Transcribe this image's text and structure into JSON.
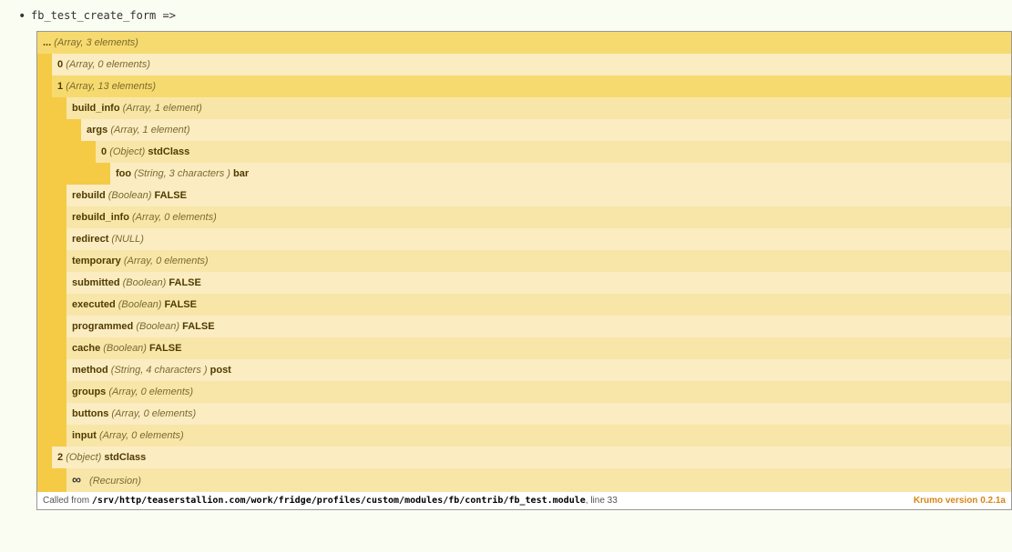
{
  "header": {
    "label": "fb_test_create_form =>"
  },
  "root": {
    "key": "...",
    "type": "(Array, 3 elements)"
  },
  "items": {
    "i0": {
      "key": "0",
      "type": "(Array, 0 elements)"
    },
    "i1": {
      "key": "1",
      "type": "(Array, 13 elements)"
    },
    "i1c": {
      "build_info": {
        "key": "build_info",
        "type": "(Array, 1 element)"
      },
      "args": {
        "key": "args",
        "type": "(Array, 1 element)"
      },
      "args0": {
        "key": "0",
        "type": "(Object)",
        "val": "stdClass"
      },
      "foo": {
        "key": "foo",
        "type": "(String, 3 characters )",
        "val": "bar"
      },
      "rebuild": {
        "key": "rebuild",
        "type": "(Boolean)",
        "val": "FALSE"
      },
      "rebuild_info": {
        "key": "rebuild_info",
        "type": "(Array, 0 elements)"
      },
      "redirect": {
        "key": "redirect",
        "type": "(NULL)"
      },
      "temporary": {
        "key": "temporary",
        "type": "(Array, 0 elements)"
      },
      "submitted": {
        "key": "submitted",
        "type": "(Boolean)",
        "val": "FALSE"
      },
      "executed": {
        "key": "executed",
        "type": "(Boolean)",
        "val": "FALSE"
      },
      "programmed": {
        "key": "programmed",
        "type": "(Boolean)",
        "val": "FALSE"
      },
      "cache": {
        "key": "cache",
        "type": "(Boolean)",
        "val": "FALSE"
      },
      "method": {
        "key": "method",
        "type": "(String, 4 characters )",
        "val": "post"
      },
      "groups": {
        "key": "groups",
        "type": "(Array, 0 elements)"
      },
      "buttons": {
        "key": "buttons",
        "type": "(Array, 0 elements)"
      },
      "input": {
        "key": "input",
        "type": "(Array, 0 elements)"
      }
    },
    "i2": {
      "key": "2",
      "type": "(Object)",
      "val": "stdClass"
    },
    "i2r": {
      "label": "(Recursion)"
    }
  },
  "footer": {
    "called_prefix": "Called from ",
    "path": "/srv/http/teaserstallion.com/work/fridge/profiles/custom/modules/fb/contrib/fb_test.module",
    "line_prefix": ", line ",
    "line": "33",
    "brand": "Krumo version 0.2.1a"
  }
}
